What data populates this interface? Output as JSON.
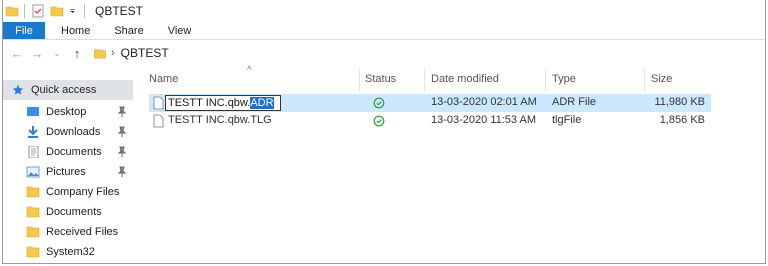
{
  "window": {
    "title": "QBTEST"
  },
  "ribbon": {
    "tabs": [
      "File",
      "Home",
      "Share",
      "View"
    ]
  },
  "address": {
    "path": "QBTEST"
  },
  "sidebar": {
    "quick_access": "Quick access",
    "items": [
      {
        "label": "Desktop",
        "icon": "desktop-icon",
        "pinned": true
      },
      {
        "label": "Downloads",
        "icon": "download-icon",
        "pinned": true
      },
      {
        "label": "Documents",
        "icon": "documents-icon",
        "pinned": true
      },
      {
        "label": "Pictures",
        "icon": "pictures-icon",
        "pinned": true
      },
      {
        "label": "Company Files",
        "icon": "folder-icon",
        "pinned": false
      },
      {
        "label": "Documents",
        "icon": "folder-icon",
        "pinned": false
      },
      {
        "label": "Received Files",
        "icon": "folder-icon",
        "pinned": false
      },
      {
        "label": "System32",
        "icon": "folder-icon",
        "pinned": false
      }
    ]
  },
  "columns": {
    "name": "Name",
    "status": "Status",
    "date": "Date modified",
    "type": "Type",
    "size": "Size"
  },
  "files": [
    {
      "name_base": "TESTT INC.qbw.",
      "name_ext": "ADR",
      "date": "13-03-2020 02:01 AM",
      "type": "ADR File",
      "size": "11,980 KB",
      "selected": true,
      "renaming": true
    },
    {
      "name": "TESTT INC.qbw.TLG",
      "date": "13-03-2020 11:53 AM",
      "type": "tlgFile",
      "size": "1,856 KB",
      "selected": false
    }
  ],
  "colors": {
    "accent": "#1979ca",
    "selection": "#cce8ff",
    "folder": "#f5c94e",
    "status_ok": "#2e9b3e"
  }
}
